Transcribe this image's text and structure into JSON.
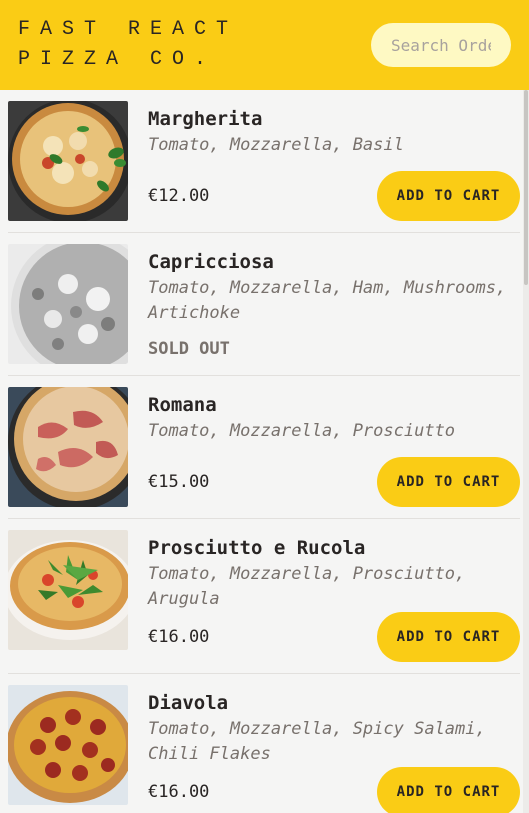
{
  "header": {
    "brand": "Fast React Pizza Co.",
    "search_placeholder": "Search Order #"
  },
  "colors": {
    "accent": "#facc15",
    "background": "#f5f5f4",
    "search_bg": "#fef9c3"
  },
  "menu": {
    "add_to_cart_label": "Add to cart",
    "sold_out_label": "Sold out",
    "items": [
      {
        "name": "Margherita",
        "ingredients": "Tomato, Mozzarella, Basil",
        "price": "€12.00",
        "sold_out": false,
        "image": "margherita-pizza"
      },
      {
        "name": "Capricciosa",
        "ingredients": "Tomato, Mozzarella, Ham, Mushrooms, Artichoke",
        "price": "",
        "sold_out": true,
        "image": "capricciosa-pizza"
      },
      {
        "name": "Romana",
        "ingredients": "Tomato, Mozzarella, Prosciutto",
        "price": "€15.00",
        "sold_out": false,
        "image": "romana-pizza"
      },
      {
        "name": "Prosciutto e Rucola",
        "ingredients": "Tomato, Mozzarella, Prosciutto, Arugula",
        "price": "€16.00",
        "sold_out": false,
        "image": "prosciutto-rucola-pizza"
      },
      {
        "name": "Diavola",
        "ingredients": "Tomato, Mozzarella, Spicy Salami, Chili Flakes",
        "price": "€16.00",
        "sold_out": false,
        "image": "diavola-pizza"
      }
    ]
  }
}
